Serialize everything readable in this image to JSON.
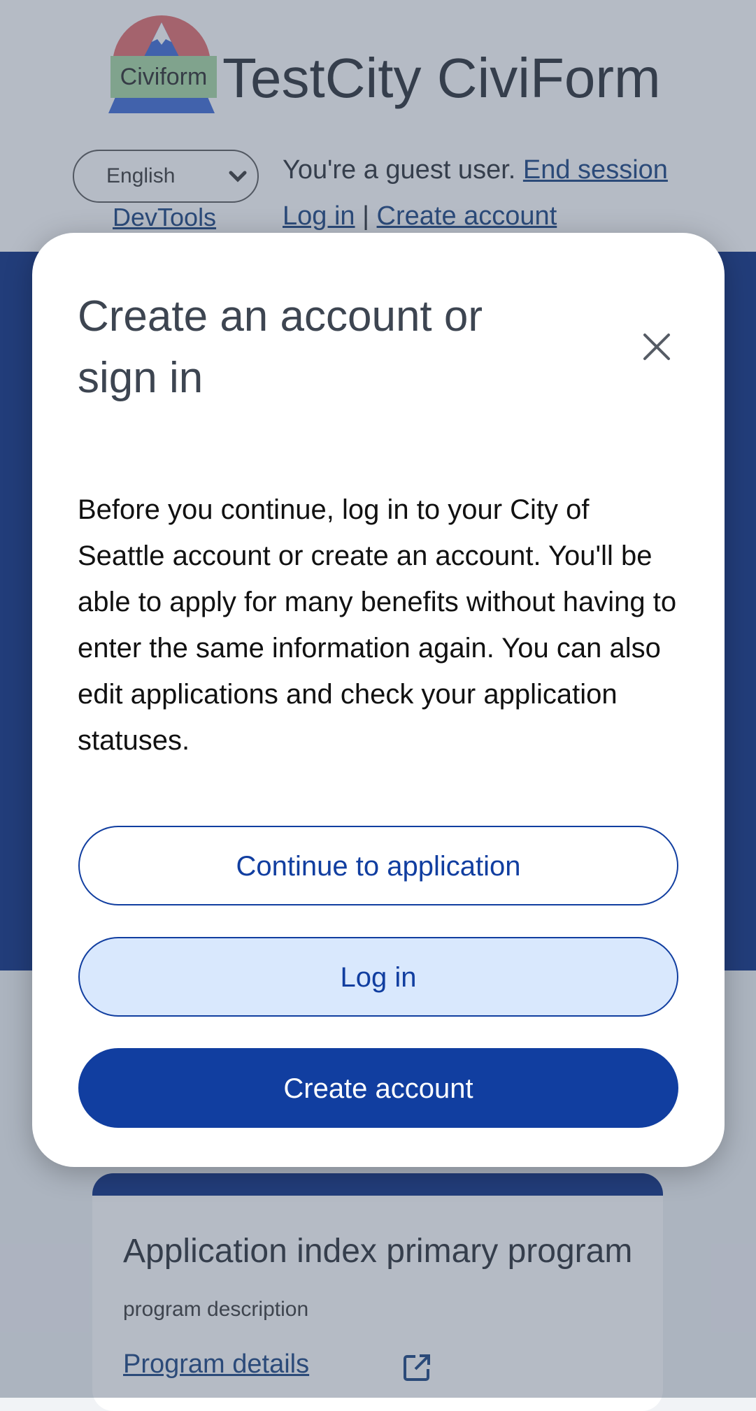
{
  "header": {
    "logo_text": "Civiform",
    "site_title": "TestCity CiviForm",
    "language": {
      "selected": "English"
    },
    "devtools_label": "DevTools",
    "guest_text": "You're a guest user.",
    "end_session_label": "End session",
    "login_label": "Log in",
    "separator": "|",
    "create_account_label": "Create account"
  },
  "program_card": {
    "title": "Application index primary program",
    "description": "program description",
    "details_link": "Program details",
    "details_icon": "open-in-new-icon"
  },
  "modal": {
    "title": "Create an account or sign in",
    "close_icon": "close-icon",
    "body": "Before you continue, log in to your City of Seattle account or create an account. You'll be able to apply for many benefits without having to enter the same information again. You can also edit applications and check your application statuses.",
    "continue_label": "Continue to application",
    "login_label": "Log in",
    "create_account_label": "Create account"
  },
  "colors": {
    "primary": "#113ea0",
    "primary_light": "#d9e8fd",
    "hero": "#0b2d83",
    "overlay": "rgba(71,84,110,0.40)"
  }
}
